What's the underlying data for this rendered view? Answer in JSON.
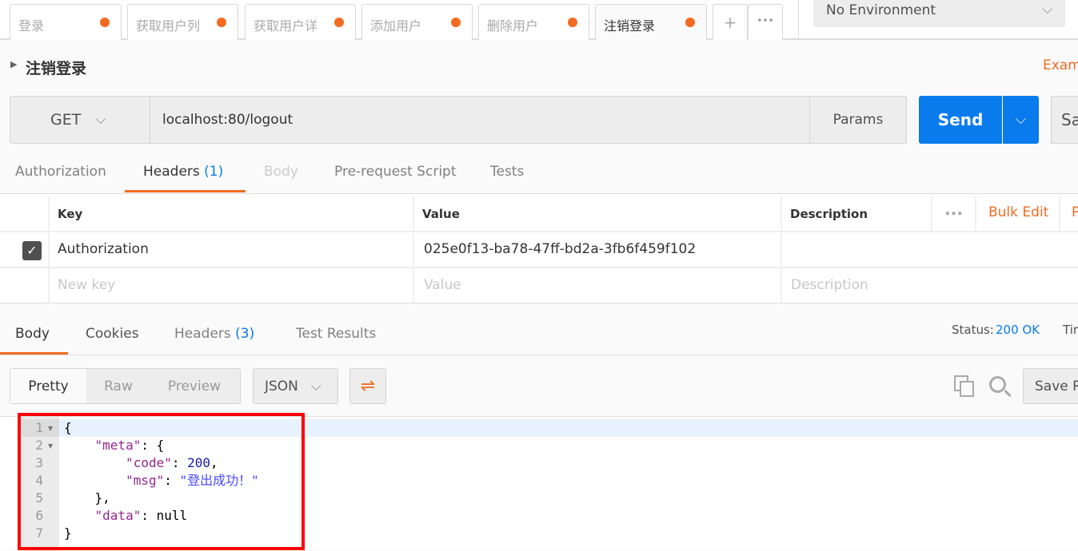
{
  "tabs": [
    {
      "label": "登录"
    },
    {
      "label": "获取用户列"
    },
    {
      "label": "获取用户详"
    },
    {
      "label": "添加用户"
    },
    {
      "label": "删除用户"
    },
    {
      "label": "注销登录",
      "active": true
    }
  ],
  "tab_add": "+",
  "tab_more": "•••",
  "environment": "No Environment",
  "request_name": "注销登录",
  "examples_link": "Exam",
  "method": "GET",
  "url": "localhost:80/logout",
  "params_label": "Params",
  "send_label": "Send",
  "save_label": "Sa",
  "request_tabs": [
    {
      "label": "Authorization"
    },
    {
      "label": "Headers",
      "count": "(1)",
      "active": true
    },
    {
      "label": "Body",
      "disabled": true
    },
    {
      "label": "Pre-request Script"
    },
    {
      "label": "Tests"
    }
  ],
  "headers_table": {
    "columns": [
      "Key",
      "Value",
      "Description"
    ],
    "more": "•••",
    "bulk_edit": "Bulk Edit",
    "presets": "P",
    "rows": [
      {
        "checked": true,
        "key": "Authorization",
        "value": "025e0f13-ba78-47ff-bd2a-3fb6f459f102",
        "description": ""
      }
    ],
    "placeholder": {
      "key": "New key",
      "value": "Value",
      "description": "Description"
    }
  },
  "response_tabs": [
    {
      "label": "Body",
      "active": true
    },
    {
      "label": "Cookies"
    },
    {
      "label": "Headers",
      "count": "(3)"
    },
    {
      "label": "Test Results"
    }
  ],
  "status_label": "Status:",
  "status_value": "200 OK",
  "time_label": "Tir",
  "view_modes": [
    "Pretty",
    "Raw",
    "Preview"
  ],
  "format": "JSON",
  "save_response": "Save R",
  "colors": {
    "accent": "#f26b21",
    "send": "#097bed",
    "link": "#097bed",
    "highlight": "#ff0000"
  },
  "code_lines": [
    "1",
    "2",
    "3",
    "4",
    "5",
    "6",
    "7"
  ],
  "json": {
    "meta_key": "\"meta\"",
    "code_key": "\"code\"",
    "code_val": "200",
    "msg_key": "\"msg\"",
    "msg_val": "\"登出成功！\"",
    "data_key": "\"data\"",
    "data_val": "null"
  }
}
